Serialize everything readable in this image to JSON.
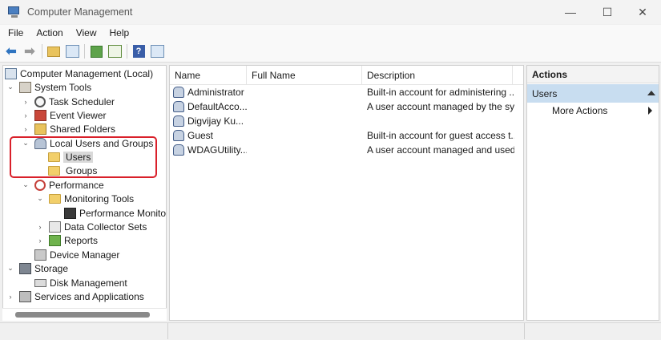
{
  "window": {
    "title": "Computer Management",
    "minimize": "—",
    "maximize": "☐",
    "close": "✕"
  },
  "menu": [
    "File",
    "Action",
    "View",
    "Help"
  ],
  "toolbar": {
    "buttons": [
      "back-icon",
      "forward-icon",
      "up-folder-icon",
      "show-hide-tree-icon",
      "refresh-icon",
      "export-icon",
      "help-icon",
      "show-hide-action-pane-icon"
    ],
    "back": "⬅",
    "forward": "➡",
    "help": "?"
  },
  "tree": {
    "root": "Computer Management (Local)",
    "system_tools": "System Tools",
    "task_scheduler": "Task Scheduler",
    "event_viewer": "Event Viewer",
    "shared_folders": "Shared Folders",
    "local_users_groups": "Local Users and Groups",
    "users": "Users",
    "groups": "Groups",
    "performance": "Performance",
    "monitoring_tools": "Monitoring Tools",
    "performance_monitor": "Performance Monitor",
    "data_collector_sets": "Data Collector Sets",
    "reports": "Reports",
    "device_manager": "Device Manager",
    "storage": "Storage",
    "disk_management": "Disk Management",
    "services_applications": "Services and Applications",
    "chevron_open": "⌄",
    "chevron_closed": "›"
  },
  "list": {
    "columns": [
      "Name",
      "Full Name",
      "Description"
    ],
    "rows": [
      {
        "name": "Administrator",
        "full_name": "",
        "description": "Built-in account for administering ..."
      },
      {
        "name": "DefaultAcco...",
        "full_name": "",
        "description": "A user account managed by the sy..."
      },
      {
        "name": "Digvijay Ku...",
        "full_name": "",
        "description": ""
      },
      {
        "name": "Guest",
        "full_name": "",
        "description": "Built-in account for guest access t..."
      },
      {
        "name": "WDAGUtility...",
        "full_name": "",
        "description": "A user account managed and used..."
      }
    ]
  },
  "actions": {
    "header": "Actions",
    "section": "Users",
    "items": [
      "More Actions"
    ]
  },
  "colors": {
    "highlight_border": "#d9202a",
    "action_section_bg": "#c8ddf0",
    "selected_bg": "#d9d9d9"
  }
}
